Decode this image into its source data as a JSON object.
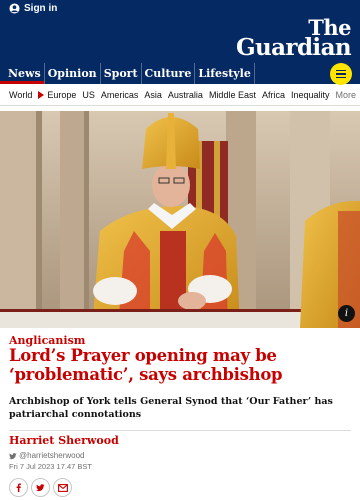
{
  "header": {
    "signin_label": "Sign in",
    "logo_line1": "The",
    "logo_line2": "Guardian",
    "background_color": "#052962",
    "accent_color": "#ffe500"
  },
  "pillars": [
    {
      "label": "News",
      "active": true
    },
    {
      "label": "Opinion",
      "active": false
    },
    {
      "label": "Sport",
      "active": false
    },
    {
      "label": "Culture",
      "active": false
    },
    {
      "label": "Lifestyle",
      "active": false
    }
  ],
  "menu_icon": "hamburger-icon",
  "subnav": {
    "items": [
      "World",
      "Europe",
      "US",
      "Americas",
      "Asia",
      "Australia",
      "Middle East",
      "Africa",
      "Inequality"
    ],
    "active_index": 1,
    "more_label": "More"
  },
  "article": {
    "kicker": "Anglicanism",
    "headline": "Lord’s Prayer opening may be ‘problematic’, says archbishop",
    "standfirst": "Archbishop of York tells General Synod that ‘Our Father’ has patriarchal connotations",
    "byline": "Harriet Sherwood",
    "twitter_handle": "@harrietsherwood",
    "date": "Fri 7 Jul 2023 17.47 BST",
    "accent_color": "#c70000"
  },
  "share_icons": [
    "facebook-icon",
    "twitter-icon",
    "email-icon"
  ],
  "image_info_icon": "info-icon"
}
